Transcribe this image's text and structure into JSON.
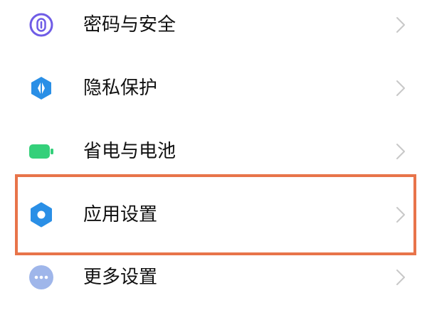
{
  "settings": {
    "items": [
      {
        "label": "密码与安全",
        "icon": "fingerprint-icon",
        "icon_color": "#6f5ce6"
      },
      {
        "label": "隐私保护",
        "icon": "privacy-shield-icon",
        "icon_color": "#2a8fe6"
      },
      {
        "label": "省电与电池",
        "icon": "battery-icon",
        "icon_color": "#34d07a"
      },
      {
        "label": "应用设置",
        "icon": "gear-icon",
        "icon_color": "#2a8fe6"
      },
      {
        "label": "更多设置",
        "icon": "more-dots-icon",
        "icon_color": "#9fb6ea"
      }
    ],
    "highlighted_item": "应用设置",
    "highlight_color": "#e8744a",
    "chevron_color": "#c8c8c8"
  }
}
